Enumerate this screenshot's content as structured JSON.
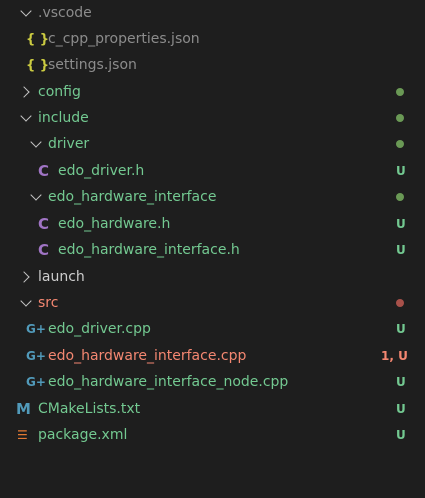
{
  "explorer": {
    "items": [
      {
        "label": ".vscode",
        "chevron": "down",
        "text_color": "#8c8c8c"
      },
      {
        "label": "c_cpp_properties.json",
        "icon": "json-icon",
        "icon_glyph": "{ }",
        "text_color": "#8c8c8c"
      },
      {
        "label": "settings.json",
        "icon": "json-icon",
        "icon_glyph": "{ }",
        "text_color": "#8c8c8c"
      },
      {
        "label": "config",
        "chevron": "right",
        "text_color": "#73c991",
        "dot": "#6a9955"
      },
      {
        "label": "include",
        "chevron": "down",
        "text_color": "#73c991",
        "dot": "#6a9955"
      },
      {
        "label": "driver",
        "chevron": "down",
        "text_color": "#73c991",
        "dot": "#6a9955"
      },
      {
        "label": "edo_driver.h",
        "icon": "c-header-icon",
        "icon_glyph": "C",
        "text_color": "#73c991",
        "badge": "U"
      },
      {
        "label": "edo_hardware_interface",
        "chevron": "down",
        "text_color": "#73c991",
        "dot": "#6a9955"
      },
      {
        "label": "edo_hardware.h",
        "icon": "c-header-icon",
        "icon_glyph": "C",
        "text_color": "#73c991",
        "badge": "U"
      },
      {
        "label": "edo_hardware_interface.h",
        "icon": "c-header-icon",
        "icon_glyph": "C",
        "text_color": "#73c991",
        "badge": "U"
      },
      {
        "label": "launch",
        "chevron": "right",
        "text_color": "#cccccc"
      },
      {
        "label": "src",
        "chevron": "down",
        "text_color": "#f48771",
        "dot": "#a8514a"
      },
      {
        "label": "edo_driver.cpp",
        "icon": "cpp-icon",
        "icon_glyph": "G+",
        "text_color": "#73c991",
        "badge": "U"
      },
      {
        "label": "edo_hardware_interface.cpp",
        "icon": "cpp-icon",
        "icon_glyph": "G+",
        "text_color": "#f48771",
        "badge": "1, U"
      },
      {
        "label": "edo_hardware_interface_node.cpp",
        "icon": "cpp-icon",
        "icon_glyph": "G+",
        "text_color": "#73c991",
        "badge": "U"
      },
      {
        "label": "CMakeLists.txt",
        "icon": "cmake-icon",
        "icon_glyph": "M",
        "text_color": "#73c991",
        "badge": "U"
      },
      {
        "label": "package.xml",
        "icon": "rss-xml-icon",
        "icon_glyph": "☰",
        "text_color": "#73c991",
        "badge": "U"
      }
    ]
  },
  "colors": {
    "background": "#1e1e1e",
    "untracked": "#73c991",
    "error": "#f48771",
    "ignored": "#8c8c8c"
  }
}
